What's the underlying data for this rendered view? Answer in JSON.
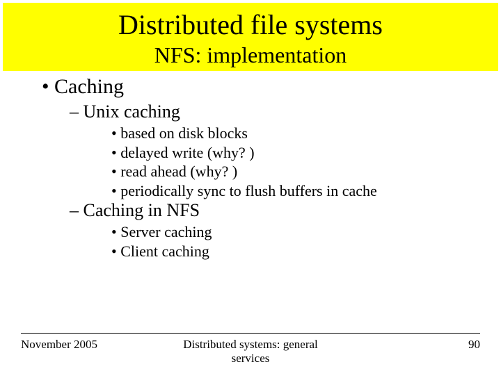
{
  "title": "Distributed file systems",
  "subtitle": "NFS: implementation",
  "bullets": {
    "l1_0": "Caching",
    "l2_0": "Unix caching",
    "l3_0": "based on disk blocks",
    "l3_1": "delayed write (why? )",
    "l3_2": "read ahead  (why? )",
    "l3_3": "periodically sync to flush buffers in cache",
    "l2_1": "Caching in NFS",
    "l3_4": "Server caching",
    "l3_5": "Client caching"
  },
  "footer": {
    "date": "November 2005",
    "center": "Distributed systems: general services",
    "page": "90"
  }
}
